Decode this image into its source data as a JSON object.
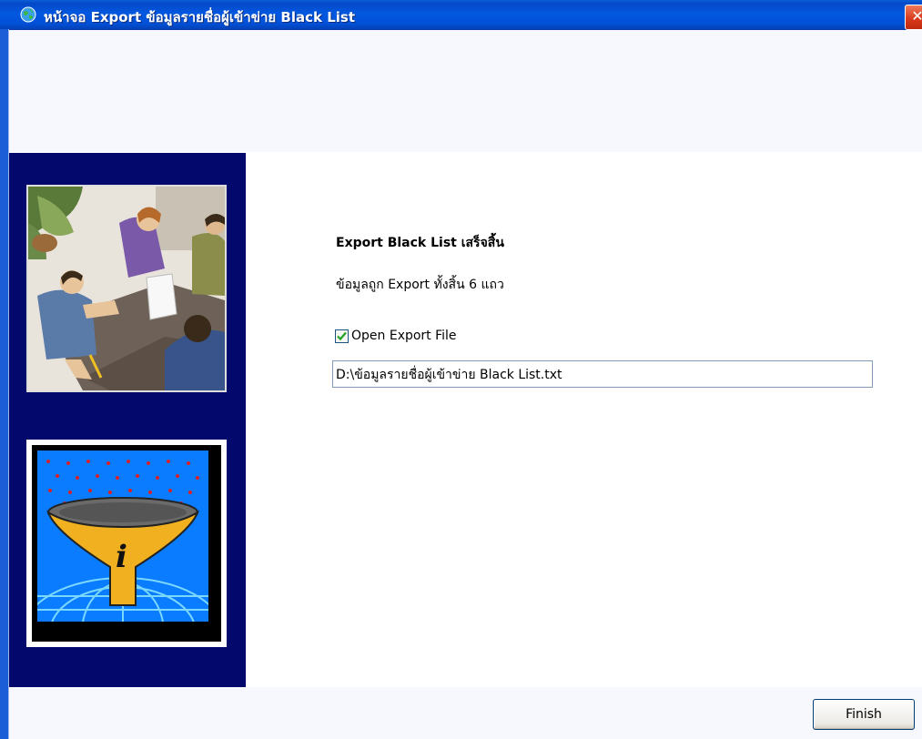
{
  "window": {
    "title": "หน้าจอ Export ข้อมูลรายชื่อผู้เข้าข่าย Black List",
    "icon": "globe-icon",
    "close_symbol": "✕"
  },
  "main": {
    "heading": "Export Black List เสร็จสิ้น",
    "row_count_text": "ข้อมูลถูก Export ทั้งสิ้น 6 แถว",
    "open_file": {
      "label": "Open Export File",
      "checked": true
    },
    "file_path": "D:\\ข้อมูลรายชื่อผู้เข้าข่าย Black List.txt"
  },
  "footer": {
    "finish_label": "Finish"
  },
  "colors": {
    "titlebar": "#0358e0",
    "side_panel": "#02086c",
    "header_bg": "#f7f8fd",
    "checkmark": "#21a121"
  }
}
